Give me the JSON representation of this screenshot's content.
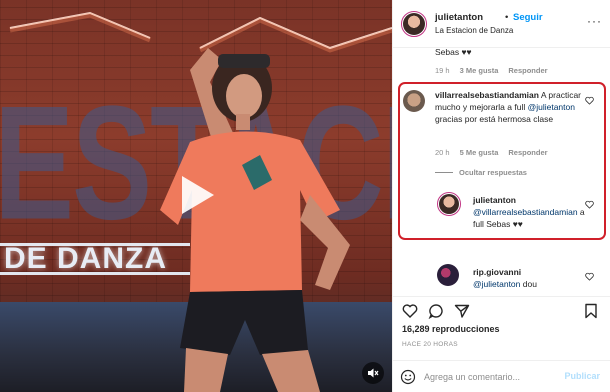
{
  "header": {
    "username": "julietanton",
    "dot": "•",
    "follow_label": "Seguir",
    "location": "La Estacion de Danza",
    "more": "···"
  },
  "video": {
    "wall_text": "ESTACIÓN",
    "sign_text": "DE DANZA"
  },
  "comments": {
    "prev_tail": {
      "text": "Sebas ♥♥",
      "time": "19 h",
      "likes": "3 Me gusta",
      "reply": "Responder"
    },
    "main": {
      "username": "villarrealsebastiandamian",
      "text_before": " A practicar mucho y mejorarla a full ",
      "mention": "@julietanton",
      "text_after": " gracias por está hermosa clase",
      "time": "20 h",
      "likes": "5 Me gusta",
      "reply": "Responder",
      "hide_replies": "Ocultar respuestas"
    },
    "reply": {
      "username": "julietanton",
      "mention": "@villarrealsebastiandamian",
      "text_after": " a full Sebas ♥♥"
    },
    "next": {
      "username": "rip.giovanni",
      "mention": "@julietanton",
      "text_after": " dou"
    }
  },
  "stats": {
    "views": "16,289 reproducciones",
    "time_ago": "HACE 20 HORAS"
  },
  "add_comment": {
    "placeholder": "Agrega un comentario...",
    "publish_label": "Publicar"
  },
  "colors": {
    "accent_blue": "#0095f6",
    "mention": "#00376b",
    "highlight": "#d0202a",
    "muted": "#8e8e8e"
  },
  "icons": [
    "play-icon",
    "mute-icon",
    "heart-icon",
    "comment-icon",
    "share-icon",
    "bookmark-icon",
    "emoji-icon",
    "more-icon"
  ]
}
